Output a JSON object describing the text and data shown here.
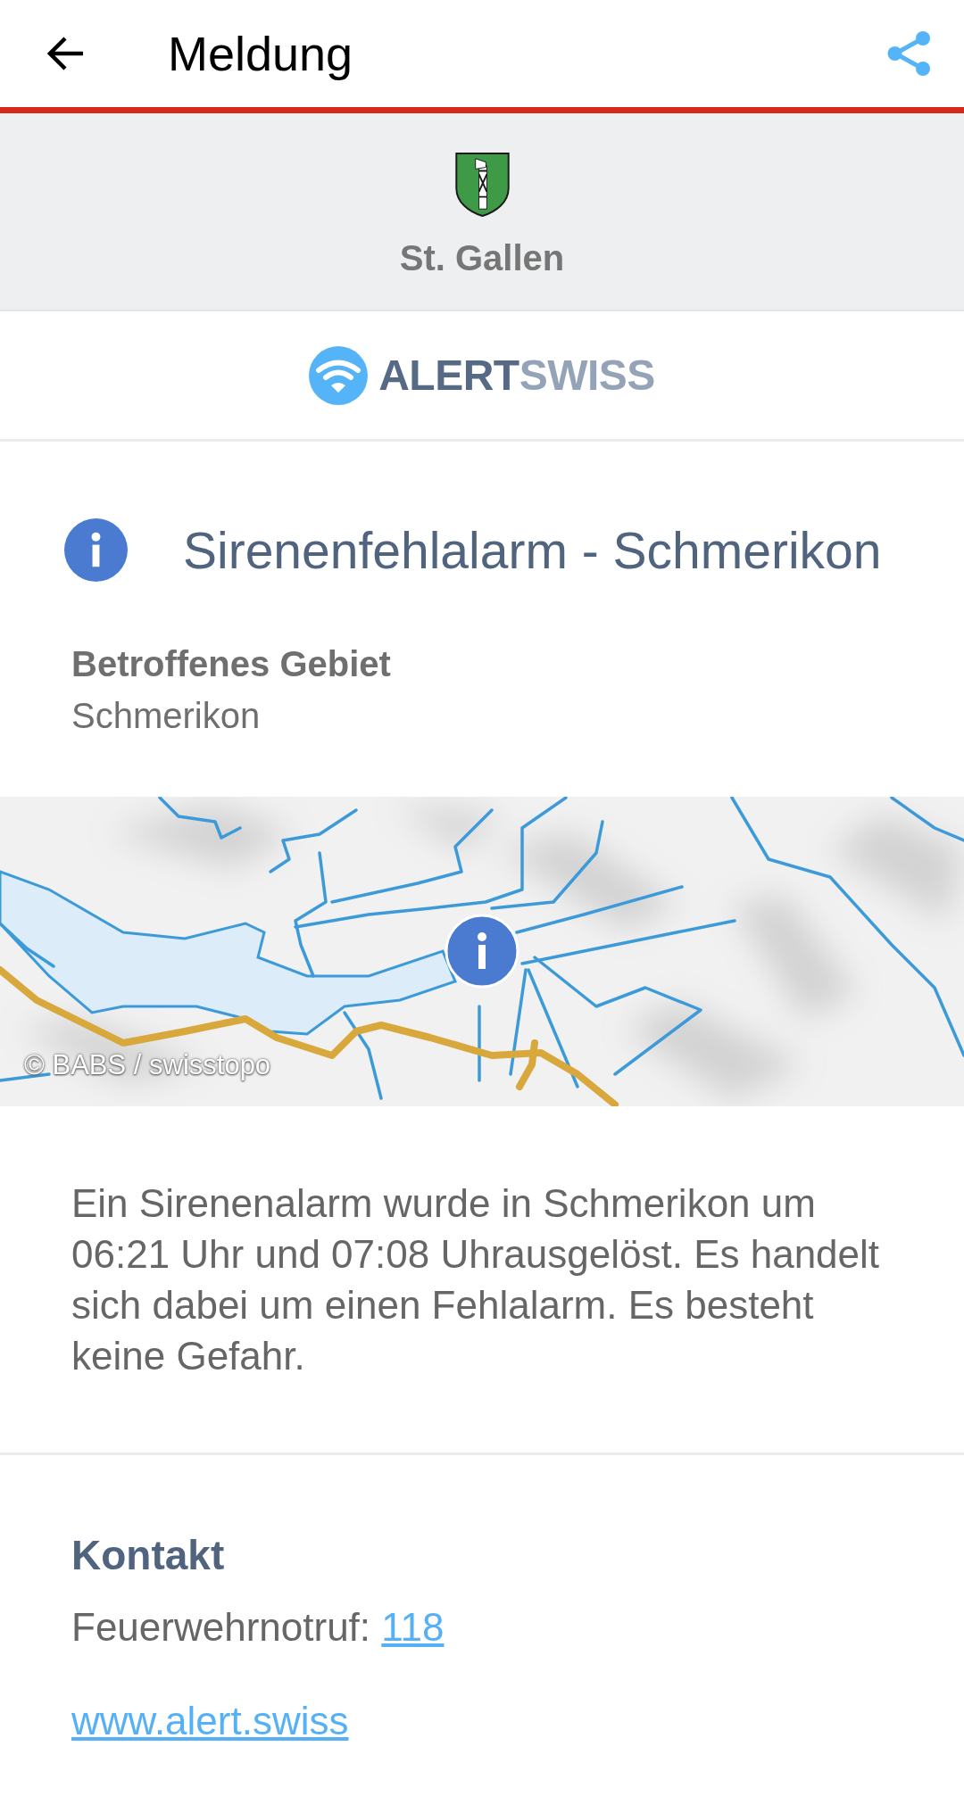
{
  "app_bar": {
    "title": "Meldung"
  },
  "region": {
    "name": "St. Gallen"
  },
  "brand": {
    "wordmark_primary": "ALERT",
    "wordmark_secondary": "SWISS"
  },
  "message": {
    "title": "Sirenenfehlalarm - Schmerikon",
    "area_label": "Betroffenes Gebiet",
    "area": "Schmerikon"
  },
  "map": {
    "attribution": "© BABS / swisstopo"
  },
  "description": "Ein Sirenenalarm wurde in Schmerikon um 06:21 Uhr und 07:08 Uhrausgelöst. Es handelt sich dabei um einen Fehlalarm. Es besteht keine Gefahr.",
  "contact": {
    "heading": "Kontakt",
    "phone_label": "Feuerwehrnotruf:",
    "phone": "118",
    "website": "www.alert.swiss"
  }
}
